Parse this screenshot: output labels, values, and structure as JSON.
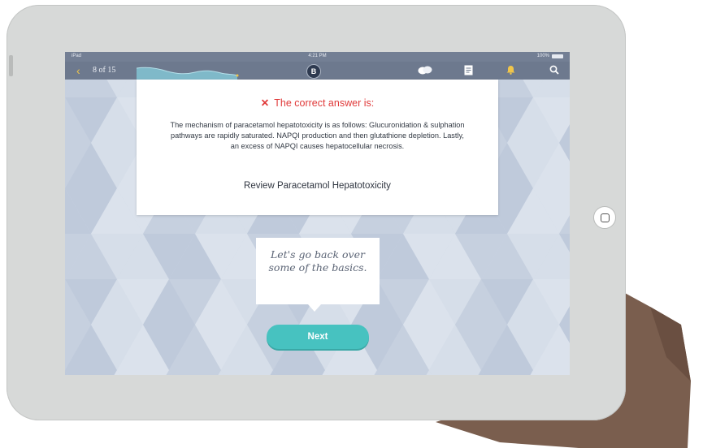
{
  "status_bar": {
    "device": "iPad",
    "time": "4:21 PM",
    "battery": "100%"
  },
  "nav": {
    "back_icon": "chevron-left-icon",
    "progress": "8 of 15",
    "badge": "B",
    "icons": [
      "chat-bubbles-icon",
      "notes-icon",
      "bell-icon",
      "search-icon"
    ]
  },
  "answer_card": {
    "heading_icon": "✕",
    "heading": "The correct answer is:",
    "body": "The mechanism of paracetamol hepatotoxicity is as follows: Glucuronidation & sulphation pathways are rapidly saturated. NAPQI production and then glutathione depletion. Lastly, an excess of NAPQI causes hepatocellular necrosis.",
    "review_link": "Review Paracetamol Hepatotoxicity"
  },
  "bubble": {
    "text": "Let's go back over some of the basics."
  },
  "next_button": "Next",
  "colors": {
    "nav_bg": "#6d798e",
    "status_bg": "#737f94",
    "error_red": "#e03a3a",
    "accent_teal": "#47c2c0",
    "bell_yellow": "#f0c54a",
    "screen_bg": "#cfd8e6"
  }
}
